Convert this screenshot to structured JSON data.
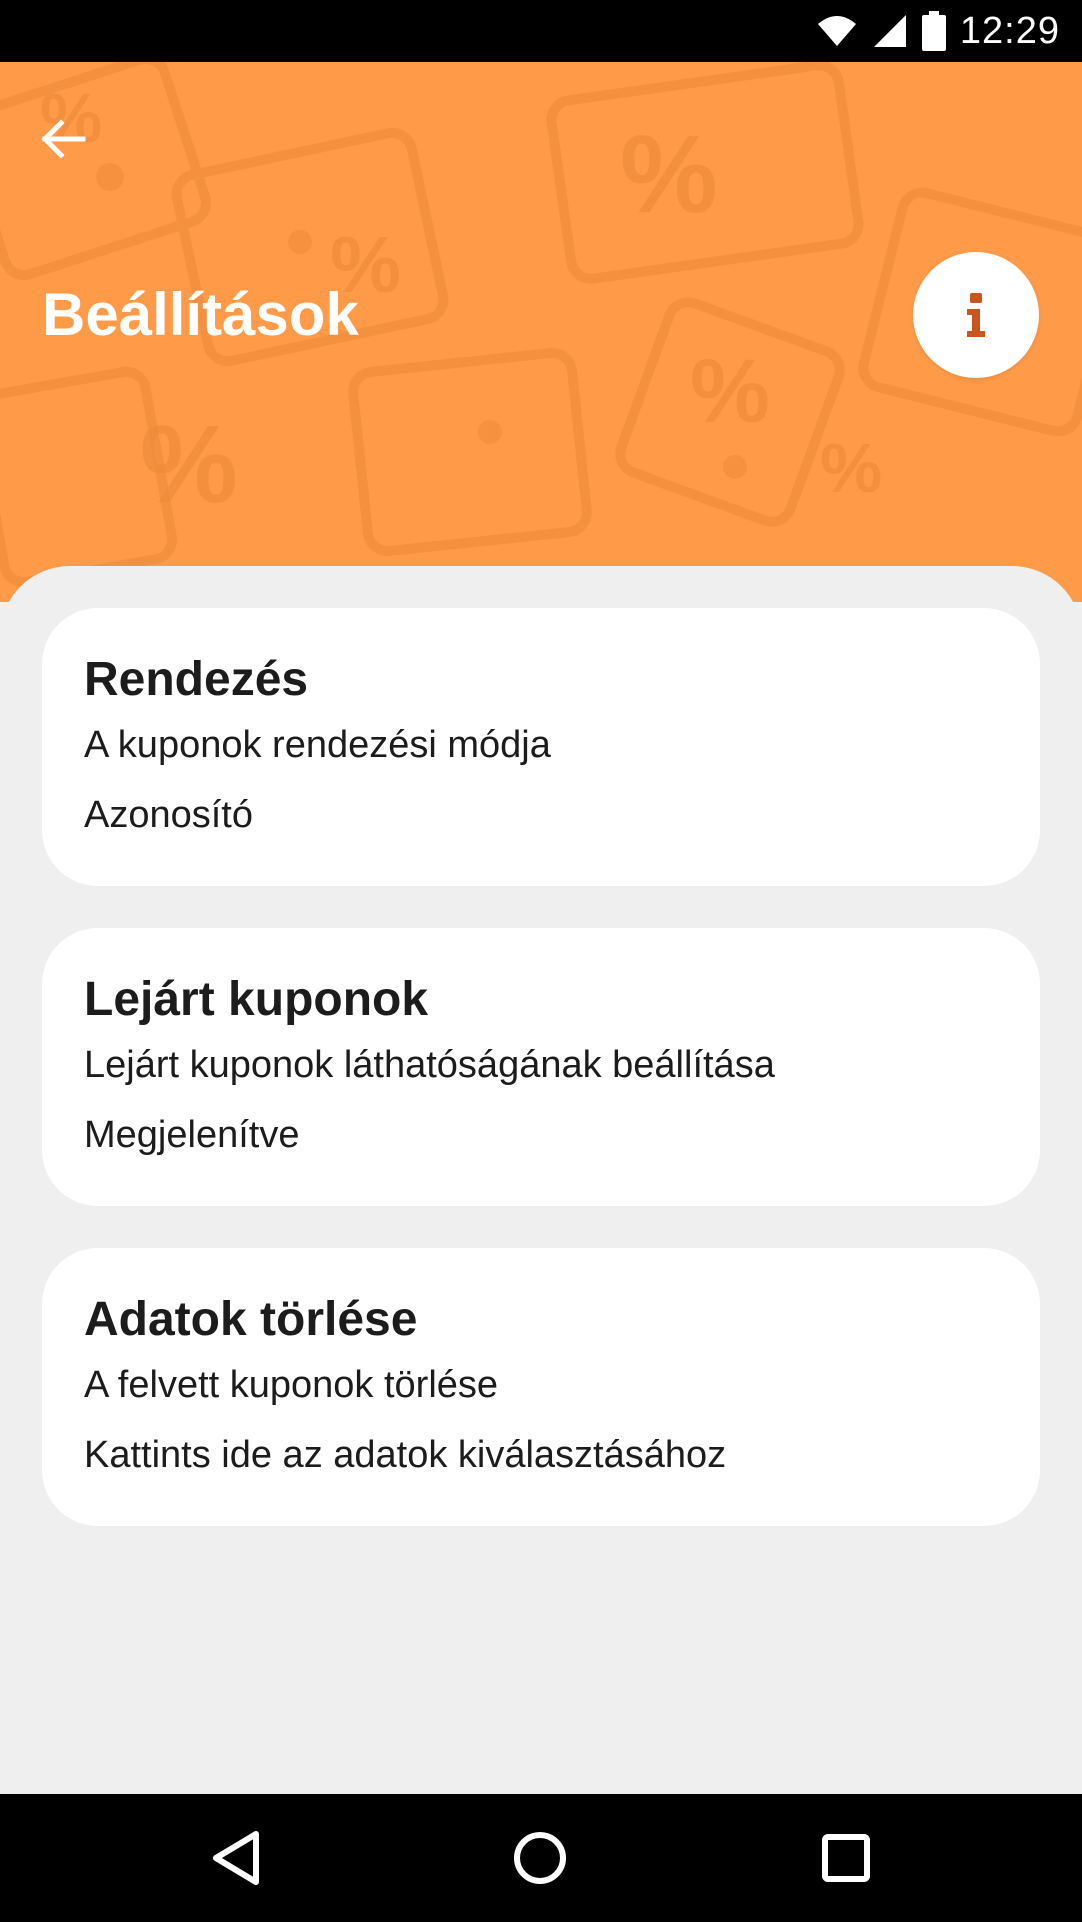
{
  "status_bar": {
    "time": "12:29",
    "icons": [
      "wifi-icon",
      "signal-icon",
      "battery-icon"
    ]
  },
  "header": {
    "title": "Beállítások",
    "back_icon": "arrow-left-icon",
    "info_icon": "info-icon",
    "background_color": "#ff9a48",
    "info_icon_color": "#c9561f"
  },
  "settings": [
    {
      "title": "Rendezés",
      "description": "A kuponok rendezési módja",
      "value": "Azonosító"
    },
    {
      "title": "Lejárt kuponok",
      "description": "Lejárt kuponok láthatóságának beállítása",
      "value": "Megjelenítve"
    },
    {
      "title": "Adatok törlése",
      "description": "A felvett kuponok törlése",
      "value": "Kattints ide az adatok kiválasztásához"
    }
  ],
  "nav_bar": {
    "icons": [
      "back-triangle-icon",
      "home-circle-icon",
      "recents-square-icon"
    ]
  }
}
